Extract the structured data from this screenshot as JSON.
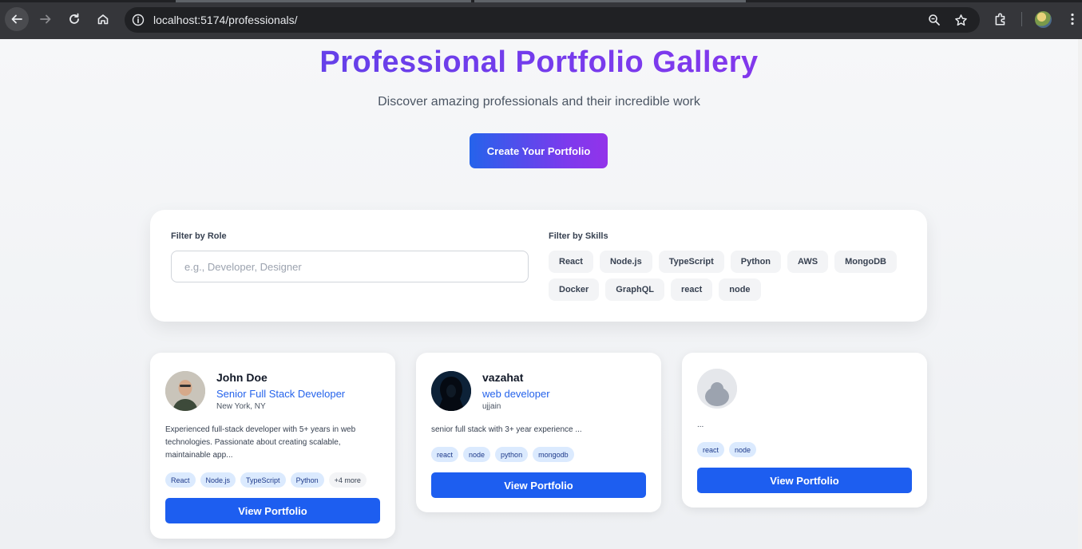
{
  "browser": {
    "url": "localhost:5174/professionals/"
  },
  "hero": {
    "title": "Professional Portfolio Gallery",
    "subtitle": "Discover amazing professionals and their incredible work",
    "cta_label": "Create Your Portfolio"
  },
  "filters": {
    "role_label": "Filter by Role",
    "role_placeholder": "e.g., Developer, Designer",
    "skills_label": "Filter by Skills",
    "skills": [
      "React",
      "Node.js",
      "TypeScript",
      "Python",
      "AWS",
      "MongoDB",
      "Docker",
      "GraphQL",
      "react",
      "node"
    ]
  },
  "cards": [
    {
      "name": "John Doe",
      "role": "Senior Full Stack Developer",
      "location": "New York, NY",
      "bio": "Experienced full-stack developer with 5+ years in web technologies. Passionate about creating scalable, maintainable app...",
      "tags": [
        "React",
        "Node.js",
        "TypeScript",
        "Python"
      ],
      "more": "+4 more",
      "button": "View Portfolio"
    },
    {
      "name": "vazahat",
      "role": "web developer",
      "location": "ujjain",
      "bio": "senior full stack with 3+ year experience ...",
      "tags": [
        "react",
        "node",
        "python",
        "mongodb"
      ],
      "button": "View Portfolio"
    },
    {
      "name": "",
      "role": "",
      "location": "",
      "bio": "...",
      "tags": [
        "react",
        "node"
      ],
      "button": "View Portfolio"
    }
  ],
  "colors": {
    "primary": "#1d5ef0",
    "gradient_start": "#4f46e5",
    "gradient_end": "#9333ea",
    "tag_bg": "#dbeafe"
  }
}
